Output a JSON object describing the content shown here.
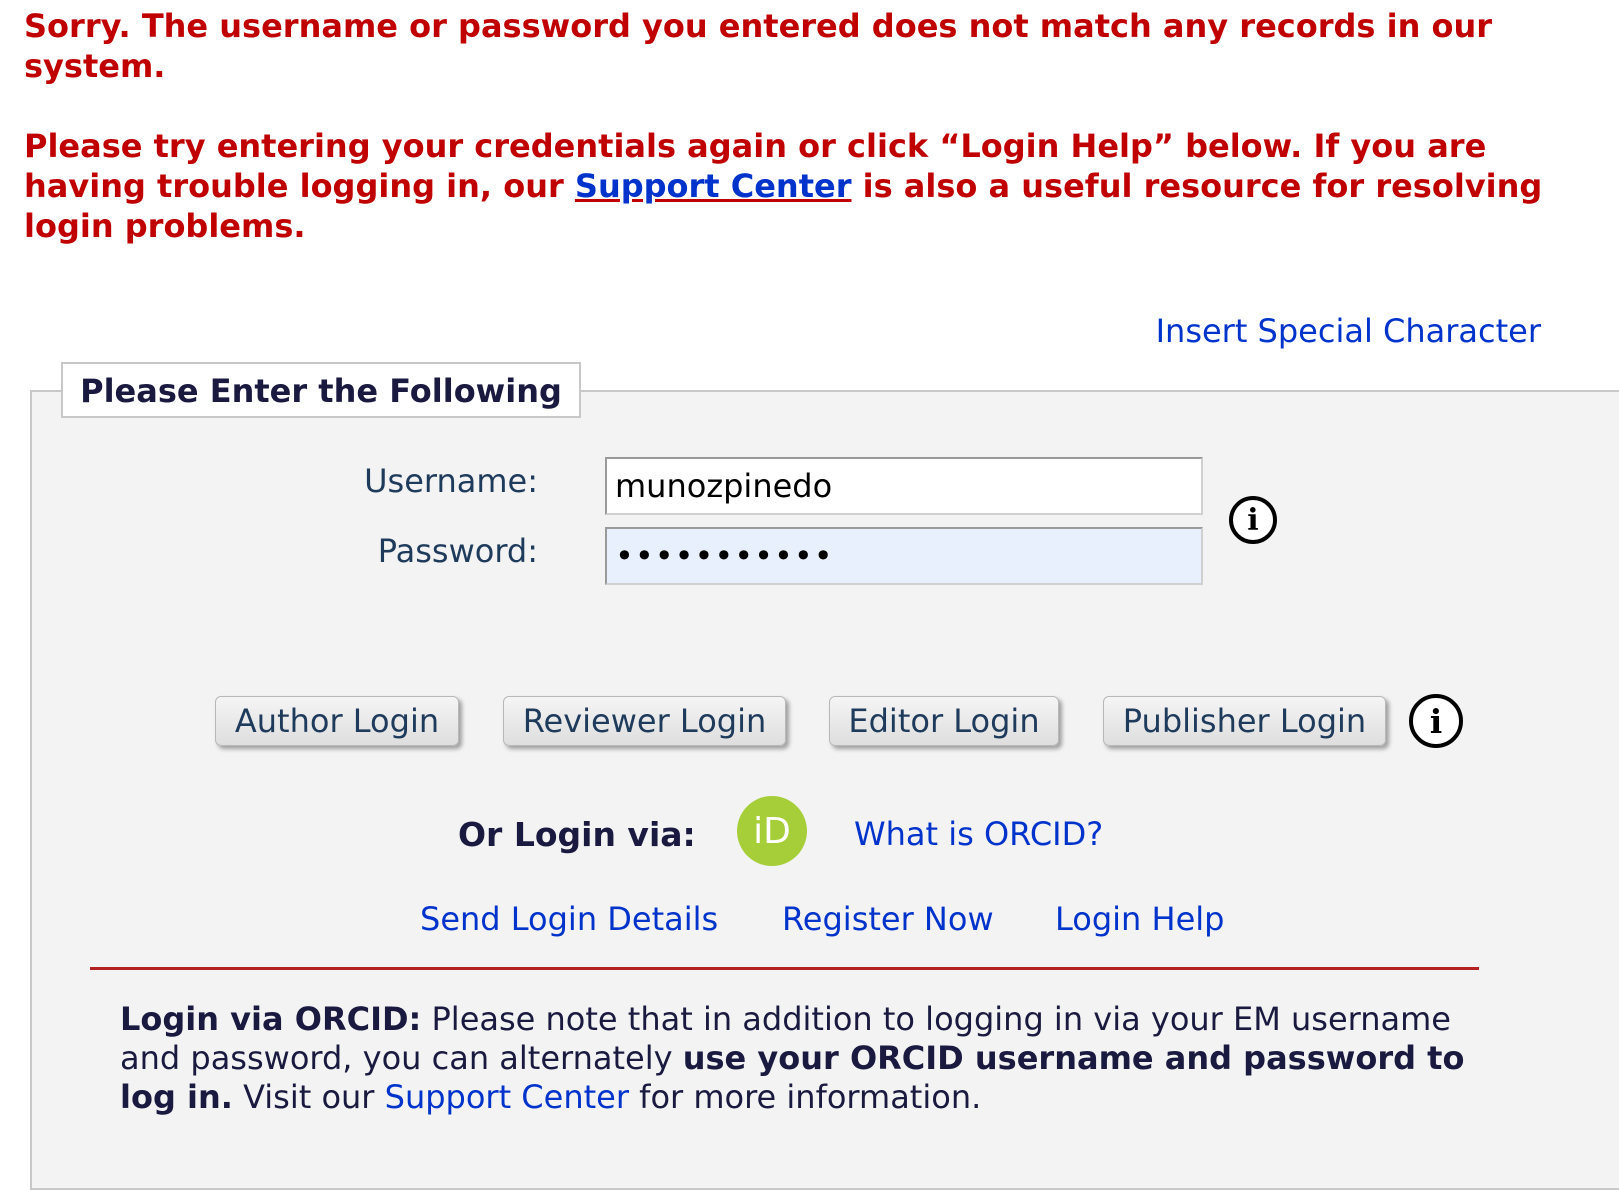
{
  "error": {
    "line1": "Sorry. The username or password you entered does not match any records in our system.",
    "line2_before": "Please try entering your credentials again or click “Login Help” below. If you are having trouble logging in, our ",
    "line2_link": "Support Center",
    "line2_after": " is also a useful resource for resolving login problems."
  },
  "special_character_link": "Insert Special Character",
  "form": {
    "legend": "Please Enter the Following",
    "username_label": "Username:",
    "username_value": "munozpinedo",
    "password_label": "Password:",
    "password_value": "•••••••••••",
    "info_icon": "i"
  },
  "buttons": {
    "author": "Author Login",
    "reviewer": "Reviewer Login",
    "editor": "Editor Login",
    "publisher": "Publisher Login"
  },
  "orcid": {
    "label": "Or Login via:",
    "logo_text": "iD",
    "what_is": "What is ORCID?"
  },
  "links": {
    "send_details": "Send Login Details",
    "register": "Register Now",
    "help": "Login Help"
  },
  "note": {
    "bold_lead": "Login via ORCID:",
    "text1": " Please note that in addition to logging in via your EM username and password, you can alternately ",
    "bold_mid": "use your ORCID username and password to log in.",
    "text2": " Visit our ",
    "link": "Support Center",
    "text3": " for more information."
  },
  "colors": {
    "error": "#c00000",
    "link": "#0033cc",
    "orcid": "#a6ce39",
    "divider": "#b22222"
  }
}
